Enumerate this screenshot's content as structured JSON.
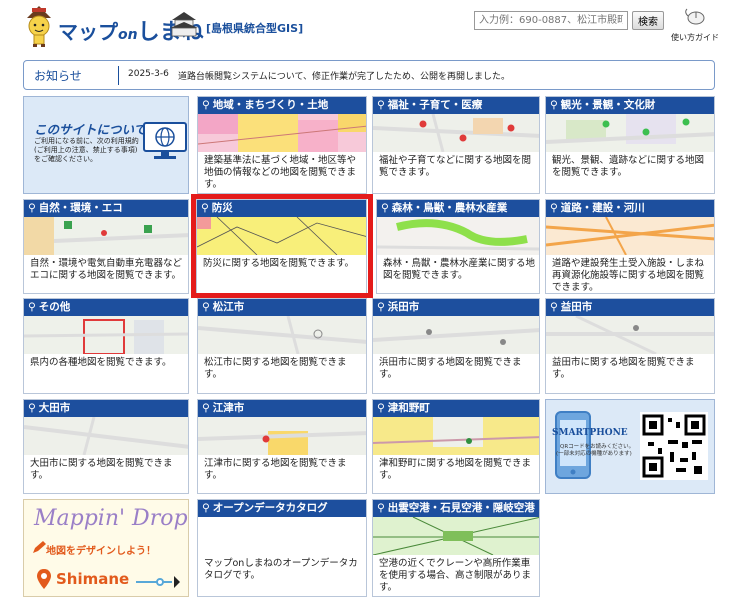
{
  "header": {
    "title_prefix": "マップ",
    "title_on": "on",
    "title_shimane": "しまね",
    "subtitle": "[島根県統合型GIS]",
    "search_placeholder": "入力例：690-0887、松江市殿町",
    "search_button": "検索",
    "guide_label": "使い方ガイド"
  },
  "news": {
    "label": "お知らせ",
    "date": "2025-3-6",
    "text": "道路台帳閲覧システムについて、修正作業が完了したため、公開を再開しました。"
  },
  "about": {
    "title": "このサイトについて",
    "text": "ご利用になる前に、次の利用規約(ご利用上の注意、禁止する事項)をご確認ください。"
  },
  "tiles": [
    {
      "id": "chiiki",
      "title": "地域・まちづくり・土地",
      "desc": "建築基準法に基づく地域・地区等や地価の情報などの地図を閲覧できます。"
    },
    {
      "id": "fukushi",
      "title": "福祉・子育て・医療",
      "desc": "福祉や子育てなどに関する地図を閲覧できます。"
    },
    {
      "id": "kanko",
      "title": "観光・景観・文化財",
      "desc": "観光、景観、遺跡などに関する地図を閲覧できます。"
    },
    {
      "id": "shizen",
      "title": "自然・環境・エコ",
      "desc": "自然・環境や電気自動車充電器などエコに関する地図を閲覧できます。"
    },
    {
      "id": "bousai",
      "title": "防災",
      "desc": "防災に関する地図を閲覧できます。"
    },
    {
      "id": "shinrin",
      "title": "森林・鳥獣・農林水産業",
      "desc": "森林・鳥獣・農林水産業に関する地図を閲覧できます。"
    },
    {
      "id": "douro",
      "title": "道路・建設・河川",
      "desc": "道路や建設発生土受入施設・しまね再資源化施設等に関する地図を閲覧できます。"
    },
    {
      "id": "sonota",
      "title": "その他",
      "desc": "県内の各種地図を閲覧できます。"
    },
    {
      "id": "matsue",
      "title": "松江市",
      "desc": "松江市に関する地図を閲覧できます。"
    },
    {
      "id": "hamada",
      "title": "浜田市",
      "desc": "浜田市に関する地図を閲覧できます。"
    },
    {
      "id": "masuda",
      "title": "益田市",
      "desc": "益田市に関する地図を閲覧できます。"
    },
    {
      "id": "oda",
      "title": "大田市",
      "desc": "大田市に関する地図を閲覧できます。"
    },
    {
      "id": "gotsu",
      "title": "江津市",
      "desc": "江津市に関する地図を閲覧できます。"
    },
    {
      "id": "tsuwano",
      "title": "津和野町",
      "desc": "津和野町に関する地図を閲覧できます。"
    },
    {
      "id": "opendata",
      "title": "オープンデータカタログ",
      "desc": "マップonしまねのオープンデータカタログです。"
    },
    {
      "id": "kuko",
      "title": "出雲空港・石見空港・隠岐空港",
      "desc": "空港の近くでクレーンや高所作業車を使用する場合、高さ制限があります。"
    }
  ],
  "smartphone": {
    "label": "SMARTPHONE",
    "sub1": "QRコードをお読みください。",
    "sub2": "(一部未対応の機種があります)"
  },
  "mappin": {
    "title": "Mappin' Drop",
    "sub": "地図をデザインしよう！",
    "shimane": "Shimane"
  },
  "colors": {
    "header_blue": "#1d4f9e",
    "highlight_red": "#e41b1b",
    "border": "#b9c6d9"
  }
}
